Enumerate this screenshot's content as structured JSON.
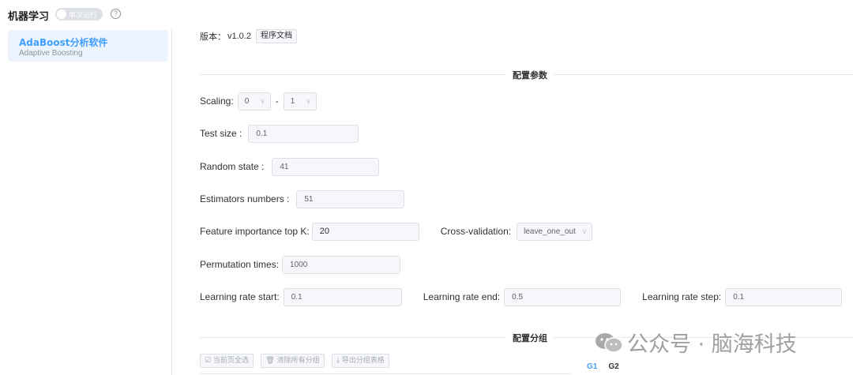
{
  "app": {
    "title": "机器学习",
    "toggle_label": "单次运行",
    "help_symbol": "?"
  },
  "sidebar": {
    "items": [
      {
        "title": "AdaBoost分析软件",
        "subtitle": "Adaptive Boosting"
      }
    ]
  },
  "version": {
    "label": "版本：",
    "value": "v1.0.2",
    "doc_button": "程序文档"
  },
  "sections": {
    "params_title": "配置参数",
    "groups_title": "配置分组"
  },
  "form": {
    "scaling": {
      "label": "Scaling:",
      "min": "0",
      "separator": "-",
      "max": "1"
    },
    "test_size": {
      "label": "Test size :",
      "value": "0.1"
    },
    "random_state": {
      "label": "Random state :",
      "value": "41"
    },
    "estimators": {
      "label": "Estimators numbers :",
      "value": "51"
    },
    "feature_topk": {
      "label": "Feature importance top K:",
      "value": "20"
    },
    "cross_validation": {
      "label": "Cross-validation:",
      "value": "leave_one_out"
    },
    "permutation": {
      "label": "Permutation times:",
      "value": "1000"
    },
    "lr_start": {
      "label": "Learning rate start:",
      "value": "0.1"
    },
    "lr_end": {
      "label": "Learning rate end:",
      "value": "0.5"
    },
    "lr_step": {
      "label": "Learning rate step:",
      "value": "0.1"
    }
  },
  "group_buttons": {
    "select_page": "☑ 当前页全选",
    "clear_groups": "🗑 清除所有分组",
    "export_table": "⤓ 导出分组表格"
  },
  "group_tabs": [
    "G1",
    "G2"
  ],
  "watermark": {
    "text": "公众号 · 脑海科技",
    "icon": "wechat-icon"
  },
  "colors": {
    "accent": "#409eff",
    "sidebar_active_bg": "#ecf5ff"
  }
}
